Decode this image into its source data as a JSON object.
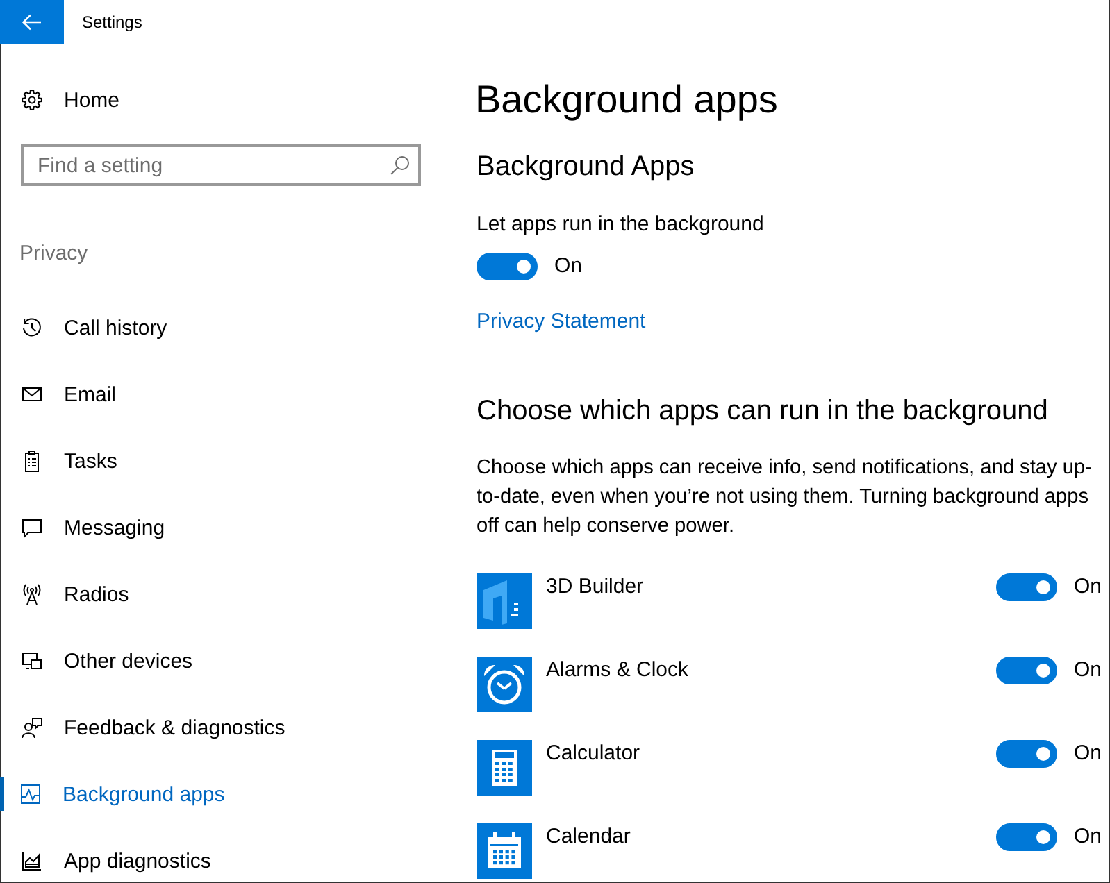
{
  "window": {
    "title": "Settings"
  },
  "sidebar": {
    "home": "Home",
    "search": {
      "placeholder": "Find a setting"
    },
    "section": "Privacy",
    "items": [
      {
        "label": "Call history",
        "selected": false
      },
      {
        "label": "Email",
        "selected": false
      },
      {
        "label": "Tasks",
        "selected": false
      },
      {
        "label": "Messaging",
        "selected": false
      },
      {
        "label": "Radios",
        "selected": false
      },
      {
        "label": "Other devices",
        "selected": false
      },
      {
        "label": "Feedback & diagnostics",
        "selected": false
      },
      {
        "label": "Background apps",
        "selected": true
      },
      {
        "label": "App diagnostics",
        "selected": false
      }
    ]
  },
  "page": {
    "title": "Background apps",
    "subtitle": "Background Apps",
    "background_toggle": {
      "label": "Let apps run in the background",
      "on": true,
      "state_label": "On"
    },
    "privacy_link": "Privacy Statement",
    "apps_heading": "Choose which apps can run in the background",
    "apps_description": "Choose which apps can receive info, send notifications, and stay up-to-date, even when you’re not using them. Turning background apps off can help conserve power.",
    "apps": [
      {
        "name": "3D Builder",
        "on": true,
        "state_label": "On"
      },
      {
        "name": "Alarms & Clock",
        "on": true,
        "state_label": "On"
      },
      {
        "name": "Calculator",
        "on": true,
        "state_label": "On"
      },
      {
        "name": "Calendar",
        "on": true,
        "state_label": "On"
      }
    ]
  }
}
